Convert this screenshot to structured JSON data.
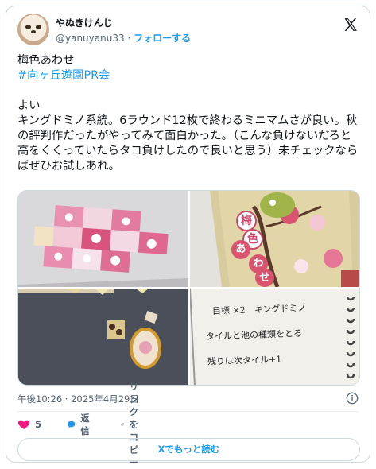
{
  "author": {
    "display_name": "やぬきけんじ",
    "handle": "@yanuyanu33",
    "separator": "·",
    "follow_label": "フォローする"
  },
  "tweet": {
    "line1": "梅色あわせ",
    "hashtag": "#向ヶ丘遊園PR会",
    "body": "よい\nキングドミノ系統。6ラウンド12枚で終わるミニマムさが良い。秋の評判作だったがやってみて面白かった。（こんな負けないだろと高をくくっていたらタコ負けしたので良いと思う）未チェックならばぜひお試しあれ。"
  },
  "media": {
    "tile_chars": [
      "梅",
      "色",
      "あ",
      "わ",
      "せ"
    ],
    "note_lines": [
      "目標 ×2　キングドミノ",
      "タイルと池の種類をとる",
      "残りは次タイル+1"
    ]
  },
  "timestamp": "午後10:26 · 2025年4月29日",
  "actions": {
    "likes_count": "5",
    "reply_label": "返信",
    "copy_link_label": "リンクをコピー"
  },
  "read_more_label": "Xでもっと読む",
  "colors": {
    "accent": "#1d9bf0",
    "like": "#f91880",
    "text": "#0f1419",
    "muted": "#536471"
  }
}
